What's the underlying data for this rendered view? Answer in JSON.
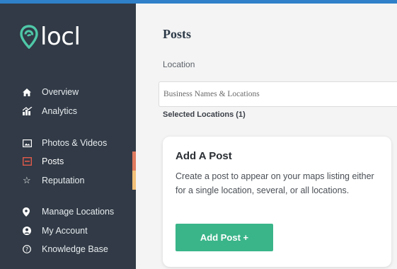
{
  "brand": {
    "name": "locl"
  },
  "sidebar": {
    "items": [
      {
        "label": "Overview",
        "icon": "home-icon"
      },
      {
        "label": "Analytics",
        "icon": "chart-icon"
      },
      {
        "label": "Photos & Videos",
        "icon": "image-icon"
      },
      {
        "label": "Posts",
        "icon": "post-icon",
        "active": true
      },
      {
        "label": "Reputation",
        "icon": "star-icon"
      },
      {
        "label": "Manage Locations",
        "icon": "location-pin-icon"
      },
      {
        "label": "My Account",
        "icon": "user-icon"
      },
      {
        "label": "Knowledge Base",
        "icon": "question-icon"
      }
    ]
  },
  "main": {
    "title": "Posts",
    "location_label": "Location",
    "location_placeholder": "Business Names & Locations",
    "selected_locations": "Selected Locations (1)",
    "card": {
      "title": "Add A Post",
      "description": "Create a post to appear on your maps listing either for a single location, several, or all locations.",
      "button_label": "Add Post +"
    }
  },
  "colors": {
    "sidebar_bg": "#313a46",
    "accent_blue": "#2f80c9",
    "active_marker": "#e07a5f",
    "reputation_marker": "#f2c078",
    "primary_button": "#3ab589",
    "logo_teal": "#4fc8a8"
  }
}
